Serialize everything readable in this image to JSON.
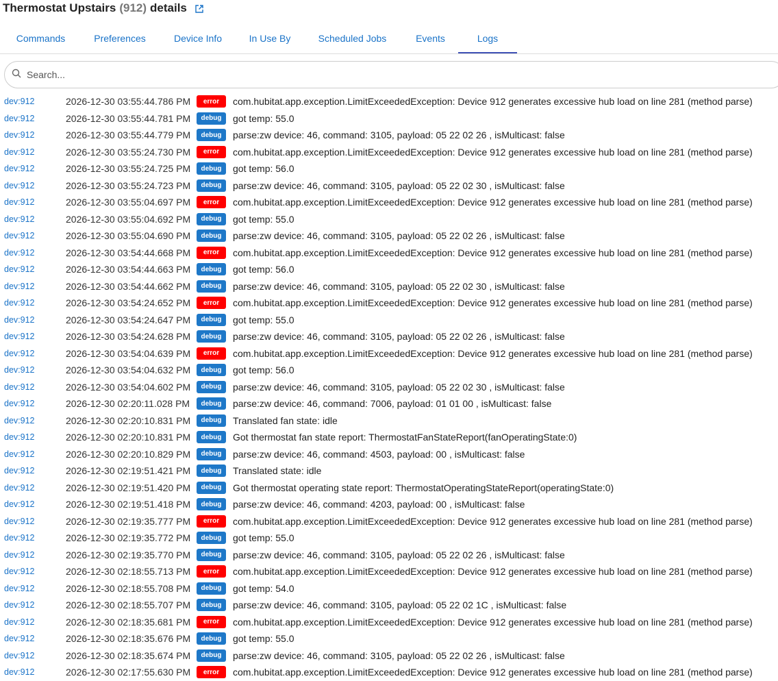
{
  "header": {
    "title_prefix": "Thermostat Upstairs",
    "device_num": "(912)",
    "title_suffix": "details"
  },
  "tabs": [
    {
      "label": "Commands"
    },
    {
      "label": "Preferences"
    },
    {
      "label": "Device Info"
    },
    {
      "label": "In Use By"
    },
    {
      "label": "Scheduled Jobs"
    },
    {
      "label": "Events"
    },
    {
      "label": "Logs",
      "active": true
    }
  ],
  "search": {
    "placeholder": "Search...",
    "value": ""
  },
  "colors": {
    "error": "#ff0000",
    "debug": "#1e78c8",
    "link": "#1a73c8",
    "tab_indicator": "#3f51b5"
  },
  "logs": [
    {
      "dev": "dev:912",
      "time": "2026-12-30 03:55:44.786 PM",
      "level": "error",
      "msg": "com.hubitat.app.exception.LimitExceededException: Device 912 generates excessive hub load on line 281 (method parse)"
    },
    {
      "dev": "dev:912",
      "time": "2026-12-30 03:55:44.781 PM",
      "level": "debug",
      "msg": "got temp: 55.0"
    },
    {
      "dev": "dev:912",
      "time": "2026-12-30 03:55:44.779 PM",
      "level": "debug",
      "msg": "parse:zw device: 46, command: 3105, payload: 05 22 02 26 , isMulticast: false"
    },
    {
      "dev": "dev:912",
      "time": "2026-12-30 03:55:24.730 PM",
      "level": "error",
      "msg": "com.hubitat.app.exception.LimitExceededException: Device 912 generates excessive hub load on line 281 (method parse)"
    },
    {
      "dev": "dev:912",
      "time": "2026-12-30 03:55:24.725 PM",
      "level": "debug",
      "msg": "got temp: 56.0"
    },
    {
      "dev": "dev:912",
      "time": "2026-12-30 03:55:24.723 PM",
      "level": "debug",
      "msg": "parse:zw device: 46, command: 3105, payload: 05 22 02 30 , isMulticast: false"
    },
    {
      "dev": "dev:912",
      "time": "2026-12-30 03:55:04.697 PM",
      "level": "error",
      "msg": "com.hubitat.app.exception.LimitExceededException: Device 912 generates excessive hub load on line 281 (method parse)"
    },
    {
      "dev": "dev:912",
      "time": "2026-12-30 03:55:04.692 PM",
      "level": "debug",
      "msg": "got temp: 55.0"
    },
    {
      "dev": "dev:912",
      "time": "2026-12-30 03:55:04.690 PM",
      "level": "debug",
      "msg": "parse:zw device: 46, command: 3105, payload: 05 22 02 26 , isMulticast: false"
    },
    {
      "dev": "dev:912",
      "time": "2026-12-30 03:54:44.668 PM",
      "level": "error",
      "msg": "com.hubitat.app.exception.LimitExceededException: Device 912 generates excessive hub load on line 281 (method parse)"
    },
    {
      "dev": "dev:912",
      "time": "2026-12-30 03:54:44.663 PM",
      "level": "debug",
      "msg": "got temp: 56.0"
    },
    {
      "dev": "dev:912",
      "time": "2026-12-30 03:54:44.662 PM",
      "level": "debug",
      "msg": "parse:zw device: 46, command: 3105, payload: 05 22 02 30 , isMulticast: false"
    },
    {
      "dev": "dev:912",
      "time": "2026-12-30 03:54:24.652 PM",
      "level": "error",
      "msg": "com.hubitat.app.exception.LimitExceededException: Device 912 generates excessive hub load on line 281 (method parse)"
    },
    {
      "dev": "dev:912",
      "time": "2026-12-30 03:54:24.647 PM",
      "level": "debug",
      "msg": "got temp: 55.0"
    },
    {
      "dev": "dev:912",
      "time": "2026-12-30 03:54:24.628 PM",
      "level": "debug",
      "msg": "parse:zw device: 46, command: 3105, payload: 05 22 02 26 , isMulticast: false"
    },
    {
      "dev": "dev:912",
      "time": "2026-12-30 03:54:04.639 PM",
      "level": "error",
      "msg": "com.hubitat.app.exception.LimitExceededException: Device 912 generates excessive hub load on line 281 (method parse)"
    },
    {
      "dev": "dev:912",
      "time": "2026-12-30 03:54:04.632 PM",
      "level": "debug",
      "msg": "got temp: 56.0"
    },
    {
      "dev": "dev:912",
      "time": "2026-12-30 03:54:04.602 PM",
      "level": "debug",
      "msg": "parse:zw device: 46, command: 3105, payload: 05 22 02 30 , isMulticast: false"
    },
    {
      "dev": "dev:912",
      "time": "2026-12-30 02:20:11.028 PM",
      "level": "debug",
      "msg": "parse:zw device: 46, command: 7006, payload: 01 01 00 , isMulticast: false"
    },
    {
      "dev": "dev:912",
      "time": "2026-12-30 02:20:10.831 PM",
      "level": "debug",
      "msg": "Translated fan state: idle"
    },
    {
      "dev": "dev:912",
      "time": "2026-12-30 02:20:10.831 PM",
      "level": "debug",
      "msg": "Got thermostat fan state report: ThermostatFanStateReport(fanOperatingState:0)"
    },
    {
      "dev": "dev:912",
      "time": "2026-12-30 02:20:10.829 PM",
      "level": "debug",
      "msg": "parse:zw device: 46, command: 4503, payload: 00 , isMulticast: false"
    },
    {
      "dev": "dev:912",
      "time": "2026-12-30 02:19:51.421 PM",
      "level": "debug",
      "msg": "Translated state: idle"
    },
    {
      "dev": "dev:912",
      "time": "2026-12-30 02:19:51.420 PM",
      "level": "debug",
      "msg": "Got thermostat operating state report: ThermostatOperatingStateReport(operatingState:0)"
    },
    {
      "dev": "dev:912",
      "time": "2026-12-30 02:19:51.418 PM",
      "level": "debug",
      "msg": "parse:zw device: 46, command: 4203, payload: 00 , isMulticast: false"
    },
    {
      "dev": "dev:912",
      "time": "2026-12-30 02:19:35.777 PM",
      "level": "error",
      "msg": "com.hubitat.app.exception.LimitExceededException: Device 912 generates excessive hub load on line 281 (method parse)"
    },
    {
      "dev": "dev:912",
      "time": "2026-12-30 02:19:35.772 PM",
      "level": "debug",
      "msg": "got temp: 55.0"
    },
    {
      "dev": "dev:912",
      "time": "2026-12-30 02:19:35.770 PM",
      "level": "debug",
      "msg": "parse:zw device: 46, command: 3105, payload: 05 22 02 26 , isMulticast: false"
    },
    {
      "dev": "dev:912",
      "time": "2026-12-30 02:18:55.713 PM",
      "level": "error",
      "msg": "com.hubitat.app.exception.LimitExceededException: Device 912 generates excessive hub load on line 281 (method parse)"
    },
    {
      "dev": "dev:912",
      "time": "2026-12-30 02:18:55.708 PM",
      "level": "debug",
      "msg": "got temp: 54.0"
    },
    {
      "dev": "dev:912",
      "time": "2026-12-30 02:18:55.707 PM",
      "level": "debug",
      "msg": "parse:zw device: 46, command: 3105, payload: 05 22 02 1C , isMulticast: false"
    },
    {
      "dev": "dev:912",
      "time": "2026-12-30 02:18:35.681 PM",
      "level": "error",
      "msg": "com.hubitat.app.exception.LimitExceededException: Device 912 generates excessive hub load on line 281 (method parse)"
    },
    {
      "dev": "dev:912",
      "time": "2026-12-30 02:18:35.676 PM",
      "level": "debug",
      "msg": "got temp: 55.0"
    },
    {
      "dev": "dev:912",
      "time": "2026-12-30 02:18:35.674 PM",
      "level": "debug",
      "msg": "parse:zw device: 46, command: 3105, payload: 05 22 02 26 , isMulticast: false"
    },
    {
      "dev": "dev:912",
      "time": "2026-12-30 02:17:55.630 PM",
      "level": "error",
      "msg": "com.hubitat.app.exception.LimitExceededException: Device 912 generates excessive hub load on line 281 (method parse)"
    }
  ]
}
